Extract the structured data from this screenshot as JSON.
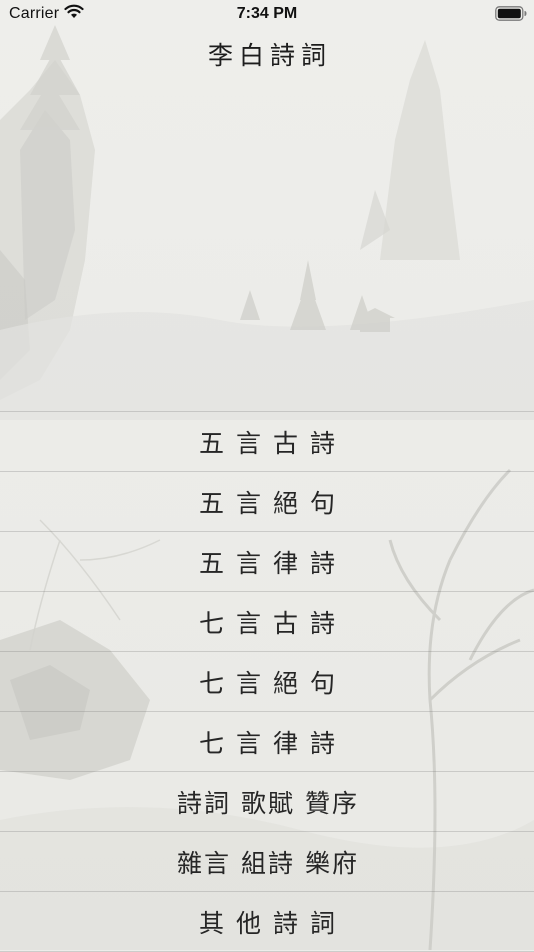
{
  "status_bar": {
    "carrier": "Carrier",
    "time": "7:34 PM",
    "wifi_icon": "wifi-icon",
    "battery_icon": "battery-icon"
  },
  "nav": {
    "title": "李白詩詞"
  },
  "menu": {
    "items": [
      {
        "label": "五言古詩"
      },
      {
        "label": "五言絕句"
      },
      {
        "label": "五言律詩"
      },
      {
        "label": "七言古詩"
      },
      {
        "label": "七言絕句"
      },
      {
        "label": "七言律詩"
      },
      {
        "label": "詩詞 歌賦 贊序"
      },
      {
        "label": "雜言 組詩 樂府"
      },
      {
        "label": "其他詩詞"
      }
    ]
  },
  "colors": {
    "background": "#ededea",
    "text": "#1f1f1f",
    "separator": "#c8c8c4"
  }
}
